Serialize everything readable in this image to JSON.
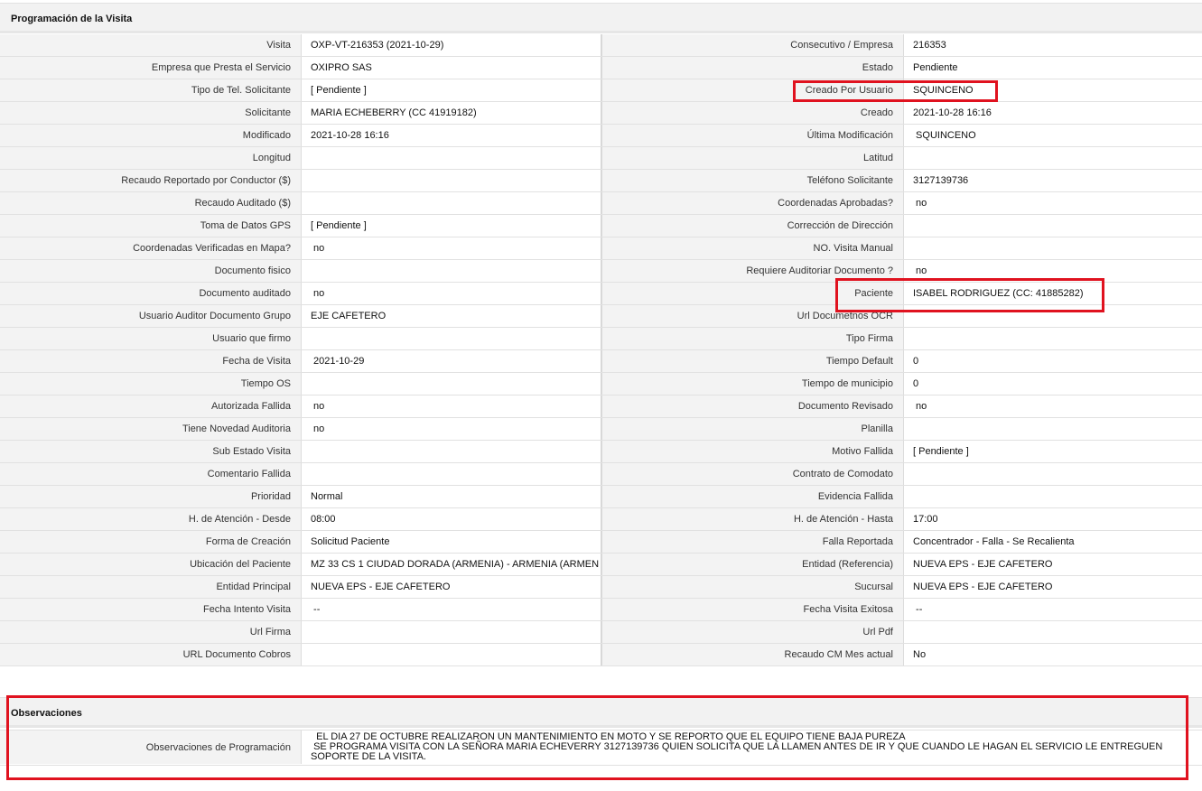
{
  "section1_title": "Programación de la Visita",
  "section2_title": "Observaciones",
  "rows": [
    {
      "l1": "Visita",
      "v1": "OXP-VT-216353 (2021-10-29)",
      "l2": "Consecutivo / Empresa",
      "v2": "216353"
    },
    {
      "l1": "Empresa que Presta el Servicio",
      "v1": "OXIPRO SAS",
      "l2": "Estado",
      "v2": "Pendiente"
    },
    {
      "l1": "Tipo de Tel. Solicitante",
      "v1": "[ Pendiente ]",
      "l2": "Creado Por Usuario",
      "v2": "SQUINCENO"
    },
    {
      "l1": "Solicitante",
      "v1": "MARIA ECHEBERRY (CC 41919182)",
      "l2": "Creado",
      "v2": "2021-10-28 16:16"
    },
    {
      "l1": "Modificado",
      "v1": "2021-10-28 16:16",
      "l2": "Última Modificación",
      "v2": " SQUINCENO"
    },
    {
      "l1": "Longitud",
      "v1": "",
      "l2": "Latitud",
      "v2": ""
    },
    {
      "l1": "Recaudo Reportado por Conductor ($)",
      "v1": "",
      "l2": "Teléfono Solicitante",
      "v2": "3127139736"
    },
    {
      "l1": "Recaudo Auditado ($)",
      "v1": "",
      "l2": "Coordenadas Aprobadas?",
      "v2": " no"
    },
    {
      "l1": "Toma de Datos GPS",
      "v1": "[ Pendiente ]",
      "l2": "Corrección de Dirección",
      "v2": ""
    },
    {
      "l1": "Coordenadas Verificadas en Mapa?",
      "v1": " no",
      "l2": "NO. Visita Manual",
      "v2": ""
    },
    {
      "l1": "Documento fisico",
      "v1": "",
      "l2": "Requiere Auditoriar Documento ?",
      "v2": " no"
    },
    {
      "l1": "Documento auditado",
      "v1": " no",
      "l2": "Paciente",
      "v2": "ISABEL RODRIGUEZ (CC: 41885282)"
    },
    {
      "l1": "Usuario Auditor Documento Grupo",
      "v1": "EJE CAFETERO",
      "l2": "Url Documetnos OCR",
      "v2": ""
    },
    {
      "l1": "Usuario que firmo",
      "v1": "",
      "l2": "Tipo Firma",
      "v2": ""
    },
    {
      "l1": "Fecha de Visita",
      "v1": " 2021-10-29",
      "l2": "Tiempo Default",
      "v2": "0"
    },
    {
      "l1": "Tiempo OS",
      "v1": "",
      "l2": "Tiempo de municipio",
      "v2": "0"
    },
    {
      "l1": "Autorizada Fallida",
      "v1": " no",
      "l2": "Documento Revisado",
      "v2": " no"
    },
    {
      "l1": "Tiene Novedad Auditoria",
      "v1": " no",
      "l2": "Planilla",
      "v2": ""
    },
    {
      "l1": "Sub Estado Visita",
      "v1": "",
      "l2": "Motivo Fallida",
      "v2": "[ Pendiente ]"
    },
    {
      "l1": "Comentario Fallida",
      "v1": "",
      "l2": "Contrato de Comodato",
      "v2": ""
    },
    {
      "l1": "Prioridad",
      "v1": "Normal",
      "l2": "Evidencia Fallida",
      "v2": ""
    },
    {
      "l1": "H. de Atención - Desde",
      "v1": "08:00",
      "l2": "H. de Atención - Hasta",
      "v2": "17:00"
    },
    {
      "l1": "Forma de Creación",
      "v1": "Solicitud Paciente",
      "l2": "Falla Reportada",
      "v2": "Concentrador - Falla - Se Recalienta"
    },
    {
      "l1": "Ubicación del Paciente",
      "v1": "MZ 33 CS 1 CIUDAD DORADA (ARMENIA) - ARMENIA (ARMEN",
      "l2": "Entidad (Referencia)",
      "v2": "NUEVA EPS - EJE CAFETERO"
    },
    {
      "l1": "Entidad Principal",
      "v1": "NUEVA EPS - EJE CAFETERO",
      "l2": "Sucursal",
      "v2": "NUEVA EPS - EJE CAFETERO"
    },
    {
      "l1": "Fecha Intento Visita",
      "v1": " --",
      "l2": "Fecha Visita Exitosa",
      "v2": " --"
    },
    {
      "l1": "Url Firma",
      "v1": "",
      "l2": "Url Pdf",
      "v2": ""
    },
    {
      "l1": "URL Documento Cobros",
      "v1": "",
      "l2": "Recaudo CM Mes actual",
      "v2": "No"
    }
  ],
  "observaciones": {
    "label": "Observaciones de Programación",
    "text": "  EL DIA 27 DE OCTUBRE REALIZARON UN MANTENIMIENTO EN MOTO Y SE REPORTO QUE EL EQUIPO TIENE BAJA PUREZA\n SE PROGRAMA VISITA CON LA SEÑORA MARIA ECHEVERRY 3127139736 QUIEN SOLICITA QUE LA LLAMEN ANTES DE IR Y QUE CUANDO LE HAGAN EL SERVICIO LE ENTREGUEN SOPORTE DE LA VISITA."
  },
  "highlight_color": "#e0121f"
}
